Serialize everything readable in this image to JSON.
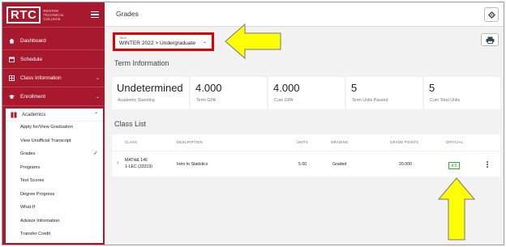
{
  "brand": {
    "logo_text": "RTC",
    "logo_sub": "RENTON TECHNICAL COLLEGE",
    "accent": "#a8192e"
  },
  "sidebar": {
    "items": [
      {
        "label": "Dashboard",
        "icon": "home-icon"
      },
      {
        "label": "Schedule",
        "icon": "calendar-icon"
      },
      {
        "label": "Class Information",
        "icon": "grid-icon"
      },
      {
        "label": "Enrollment",
        "icon": "graduation-cap-icon"
      }
    ],
    "academics": {
      "label": "Academics",
      "subitems": [
        "Apply for/View Graduation",
        "View Unofficial Transcript",
        "Grades",
        "Programs",
        "Test Scores",
        "Degree Progress",
        "What-If",
        "Advisor Information",
        "Transfer Credit"
      ],
      "active": "Grades"
    }
  },
  "header": {
    "title": "Grades"
  },
  "term": {
    "label": "Term",
    "value": "WINTER 2022 > Undergraduate"
  },
  "term_info": {
    "heading": "Term Information",
    "cards": [
      {
        "value": "Undetermined",
        "label": "Academic Standing"
      },
      {
        "value": "4.000",
        "label": "Term GPA"
      },
      {
        "value": "4.000",
        "label": "Cum GPA"
      },
      {
        "value": "5",
        "label": "Term Units Passed"
      },
      {
        "value": "5",
        "label": "Cum Total Units"
      }
    ]
  },
  "class_list": {
    "heading": "Class List",
    "columns": [
      "CLASS",
      "DESCRIPTION",
      "UNITS",
      "GRADING",
      "GRADE POINTS",
      "OFFICIAL"
    ],
    "rows": [
      {
        "class_line1": "MATH& 146",
        "class_line2": "1-LEC (33319)",
        "description": "Intro to Statistics",
        "units": "5.00",
        "grading": "Graded",
        "grade_points": "20.000",
        "official": "4.0"
      }
    ]
  },
  "colors": {
    "highlight_border": "#e00000",
    "arrow_fill": "#ffff00",
    "badge_green": "#3aaa3a"
  }
}
